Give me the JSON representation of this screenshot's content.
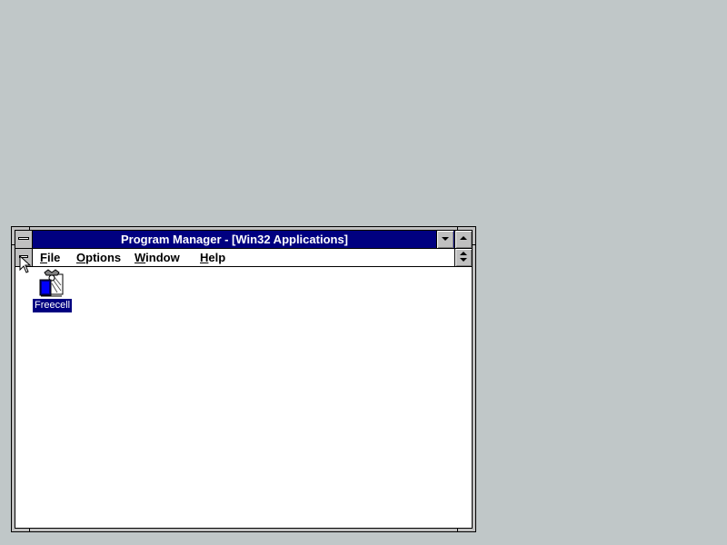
{
  "desktop": {
    "background_color": "#c0c7c8"
  },
  "window": {
    "title": "Program Manager - [Win32 Applications]",
    "title_bar_color": "#000080",
    "system_menu_icon": "system-menu-bar-icon",
    "minimize_icon": "triangle-down-icon",
    "maximize_icon": "triangle-up-icon",
    "restore_icon": "up-down-arrows-icon"
  },
  "menu": {
    "file": {
      "hotkey": "F",
      "rest": "ile"
    },
    "options": {
      "hotkey": "O",
      "rest": "ptions"
    },
    "window": {
      "hotkey": "W",
      "rest": "indow"
    },
    "help": {
      "hotkey": "H",
      "rest": "elp"
    }
  },
  "group": {
    "items": [
      {
        "label": "Freecell",
        "icon": "freecell-icon",
        "selected": true
      }
    ]
  },
  "cursor": {
    "icon": "arrow-cursor-icon"
  }
}
